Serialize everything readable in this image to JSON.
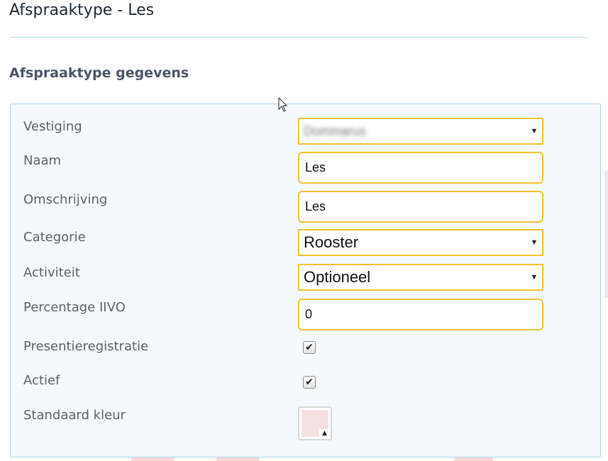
{
  "header": {
    "title": "Afspraaktype - Les",
    "section_title": "Afspraaktype gegevens"
  },
  "form": {
    "vestiging": {
      "label": "Vestiging",
      "value": "Dommarus"
    },
    "naam": {
      "label": "Naam",
      "value": "Les"
    },
    "omschrijving": {
      "label": "Omschrijving",
      "value": "Les"
    },
    "categorie": {
      "label": "Categorie",
      "value": "Rooster"
    },
    "activiteit": {
      "label": "Activiteit",
      "value": "Optioneel"
    },
    "percentage": {
      "label": "Percentage IIVO",
      "value": "0"
    },
    "presentie": {
      "label": "Presentieregistratie",
      "checked": true
    },
    "actief": {
      "label": "Actief",
      "checked": true
    },
    "kleur": {
      "label": "Standaard kleur",
      "color": "#f5e1e1"
    }
  },
  "glyphs": {
    "caret": "▼",
    "check": "✔",
    "up": "▲"
  },
  "colors": {
    "accent_border": "#f1c232",
    "panel_bg": "#f3f9fc",
    "panel_border": "#a9d6e6"
  }
}
